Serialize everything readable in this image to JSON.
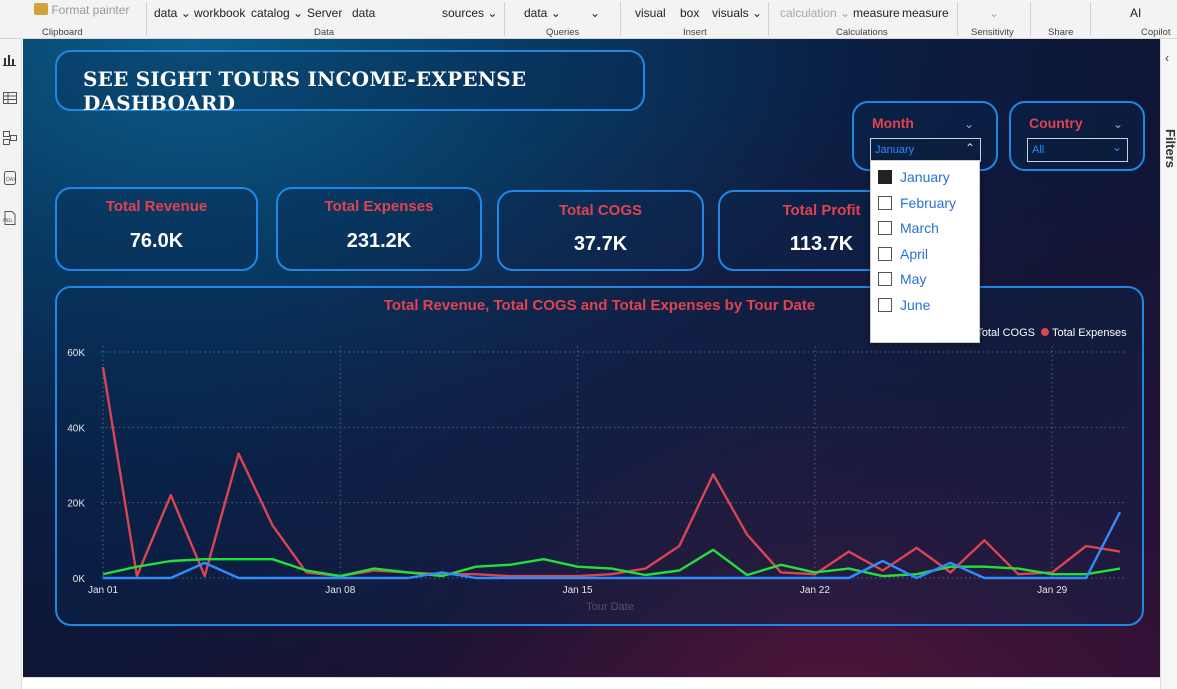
{
  "ribbon": {
    "format_painter": "Format painter",
    "items": [
      {
        "l1": "data",
        "l2": ""
      },
      {
        "l1": "workbook",
        "l2": "catalog"
      },
      {
        "l1": "Server",
        "l2": "data"
      },
      {
        "l1": "sources",
        "l2": ""
      },
      {
        "l1": "data",
        "l2": ""
      },
      {
        "l1": "visual",
        "l2": "box"
      },
      {
        "l1": "visuals",
        "l2": ""
      },
      {
        "l1": "calculation",
        "l2": "measure"
      },
      {
        "l1": "measure",
        "l2": ""
      },
      {
        "l1": "AI",
        "l2": ""
      }
    ],
    "labels": {
      "get_data": "data",
      "excel": "workbook",
      "onelake": "catalog",
      "sql": "Server",
      "enter": "data",
      "recent": "sources",
      "transform": "data",
      "new_visual": "visual",
      "text_box": "box",
      "more_visuals": "visuals",
      "new_visual_calc": "calculation",
      "new_measure": "measure",
      "quick_measure": "measure",
      "prep_ai": "AI"
    },
    "groups": {
      "clipboard": "Clipboard",
      "data": "Data",
      "queries": "Queries",
      "insert": "Insert",
      "calculations": "Calculations",
      "sensitivity": "Sensitivity",
      "share": "Share",
      "copilot": "Copilot"
    }
  },
  "right_pane": {
    "filters_label": "Filters"
  },
  "dashboard": {
    "title": "SEE SIGHT TOURS INCOME-EXPENSE DASHBOARD",
    "kpis": [
      {
        "label": "Total Revenue",
        "value": "76.0K"
      },
      {
        "label": "Total Expenses",
        "value": "231.2K"
      },
      {
        "label": "Total COGS",
        "value": "37.7K"
      },
      {
        "label": "Total Profit",
        "value": "113.7K"
      }
    ],
    "month_slicer": {
      "title": "Month",
      "selected": "January"
    },
    "country_slicer": {
      "title": "Country",
      "selected": "All"
    },
    "month_options": [
      {
        "label": "January",
        "checked": true
      },
      {
        "label": "February",
        "checked": false
      },
      {
        "label": "March",
        "checked": false
      },
      {
        "label": "April",
        "checked": false
      },
      {
        "label": "May",
        "checked": false
      },
      {
        "label": "June",
        "checked": false
      }
    ]
  },
  "colors": {
    "revenue": "#2f8cff",
    "cogs": "#22e03a",
    "expenses": "#d94552",
    "accent": "#1f87e6"
  },
  "chart_data": {
    "type": "line",
    "title": "Total Revenue, Total COGS and Total Expenses by Tour Date",
    "xlabel": "Tour Date",
    "ylabel": "",
    "legend": [
      "Total COGS",
      "Total Expenses"
    ],
    "legend_position": "top-right",
    "ylim": [
      0,
      60000
    ],
    "yticks": [
      "0K",
      "20K",
      "40K",
      "60K"
    ],
    "xticks": [
      "Jan 01",
      "Jan 08",
      "Jan 15",
      "Jan 22",
      "Jan 29"
    ],
    "x": [
      "Jan 01",
      "Jan 02",
      "Jan 03",
      "Jan 04",
      "Jan 05",
      "Jan 06",
      "Jan 07",
      "Jan 08",
      "Jan 09",
      "Jan 10",
      "Jan 11",
      "Jan 12",
      "Jan 13",
      "Jan 14",
      "Jan 15",
      "Jan 16",
      "Jan 17",
      "Jan 18",
      "Jan 19",
      "Jan 20",
      "Jan 21",
      "Jan 22",
      "Jan 23",
      "Jan 24",
      "Jan 25",
      "Jan 26",
      "Jan 27",
      "Jan 28",
      "Jan 29",
      "Jan 30",
      "Jan 31"
    ],
    "series": [
      {
        "name": "Total Expenses",
        "values": [
          56000,
          500,
          22000,
          500,
          33000,
          14000,
          1500,
          500,
          2000,
          1500,
          1000,
          1000,
          500,
          500,
          500,
          1000,
          2500,
          8500,
          27500,
          11500,
          1500,
          1000,
          7000,
          2000,
          8000,
          1500,
          10000,
          1000,
          1500,
          8500,
          7000
        ]
      },
      {
        "name": "Total COGS",
        "values": [
          1000,
          3000,
          4500,
          5000,
          5000,
          5000,
          2000,
          500,
          2500,
          1500,
          500,
          3000,
          3500,
          5000,
          3000,
          2500,
          800,
          2000,
          7500,
          800,
          3500,
          1500,
          2500,
          500,
          1000,
          3000,
          3000,
          2500,
          1000,
          1000,
          2500
        ]
      },
      {
        "name": "Total Revenue",
        "values": [
          0,
          0,
          0,
          4000,
          0,
          0,
          0,
          0,
          0,
          0,
          1500,
          0,
          0,
          0,
          0,
          0,
          0,
          0,
          0,
          0,
          0,
          0,
          0,
          4500,
          0,
          4000,
          0,
          0,
          0,
          0,
          17500
        ]
      }
    ]
  }
}
